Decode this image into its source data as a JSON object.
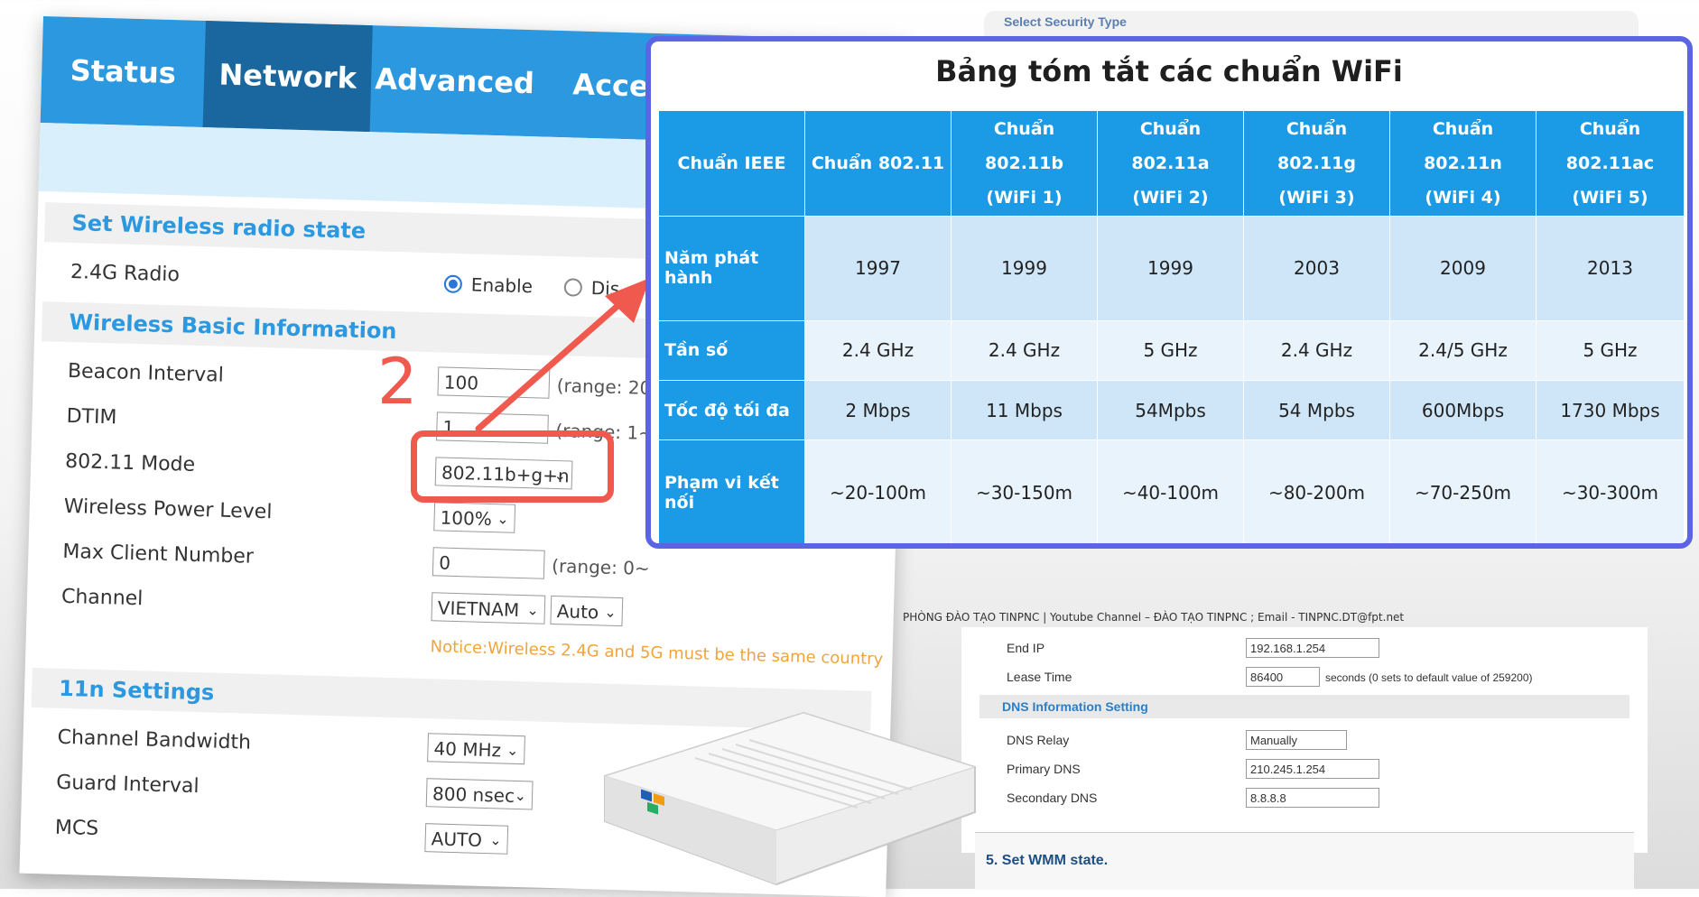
{
  "router_ui": {
    "tabs": [
      "Status",
      "Network",
      "Advanced",
      "Acces"
    ],
    "active_tab": "Network",
    "sections": {
      "radio_state": "Set Wireless radio state",
      "basic_info": "Wireless Basic Information",
      "n11": "11n Settings"
    },
    "radio": {
      "label": "2.4G Radio",
      "enable": "Enable",
      "disable": "Dis",
      "selected": "Enable"
    },
    "fields": {
      "beacon_interval": {
        "label": "Beacon Interval",
        "value": "100",
        "range": "(range: 20"
      },
      "dtim": {
        "label": "DTIM",
        "value": "1",
        "range": "(range: 1~"
      },
      "mode": {
        "label": "802.11 Mode",
        "value": "802.11b+g+n"
      },
      "power": {
        "label": "Wireless Power Level",
        "value": "100%"
      },
      "max_client": {
        "label": "Max Client Number",
        "value": "0",
        "range": "(range: 0~"
      },
      "channel": {
        "label": "Channel",
        "country": "VIETNAM",
        "value": "Auto"
      },
      "bandwidth": {
        "label": "Channel Bandwidth",
        "value": "40 MHz"
      },
      "guard": {
        "label": "Guard Interval",
        "value": "800 nsec"
      },
      "mcs": {
        "label": "MCS",
        "value": "AUTO"
      }
    },
    "notice": "Notice:Wireless 2.4G and 5G must be the same country"
  },
  "background_page": {
    "security_type_label": "Select Security Type",
    "footer": "PHÒNG ĐÀO TẠO TINPNC | Youtube Channel – ĐÀO TẠO TINPNC ; Email - TINPNC.DT@fpt.net",
    "end_ip": {
      "label": "End IP",
      "value": "192.168.1.254"
    },
    "lease_time": {
      "label": "Lease Time",
      "value": "86400",
      "note": "seconds (0 sets to default value of 259200)"
    },
    "dns_section": "DNS Information Setting",
    "dns_relay": {
      "label": "DNS Relay",
      "value": "Manually"
    },
    "primary_dns": {
      "label": "Primary DNS",
      "value": "210.245.1.254"
    },
    "secondary_dns": {
      "label": "Secondary DNS",
      "value": "8.8.8.8"
    },
    "wmm": "5. Set WMM state."
  },
  "annotation": {
    "number": "2"
  },
  "wifi_table": {
    "title": "Bảng tóm tắt các chuẩn WiFi",
    "header_corner": "Chuẩn IEEE",
    "columns": [
      {
        "line1": "Chuẩn 802.11",
        "line2": ""
      },
      {
        "line1": "Chuẩn 802.11b",
        "line2": "(WiFi 1)"
      },
      {
        "line1": "Chuẩn 802.11a",
        "line2": "(WiFi 2)"
      },
      {
        "line1": "Chuẩn 802.11g",
        "line2": "(WiFi 3)"
      },
      {
        "line1": "Chuẩn 802.11n",
        "line2": "(WiFi 4)"
      },
      {
        "line1": "Chuẩn 802.11ac",
        "line2": "(WiFi 5)"
      }
    ],
    "rows": [
      {
        "label": "Năm phát hành",
        "values": [
          "1997",
          "1999",
          "1999",
          "2003",
          "2009",
          "2013"
        ]
      },
      {
        "label": "Tần số",
        "values": [
          "2.4 GHz",
          "2.4 GHz",
          "5 GHz",
          "2.4 GHz",
          "2.4/5 GHz",
          "5 GHz"
        ]
      },
      {
        "label": "Tốc độ tối đa",
        "values": [
          "2 Mbps",
          "11 Mbps",
          "54Mpbs",
          "54 Mpbs",
          "600Mbps",
          "1730 Mbps"
        ]
      },
      {
        "label": "Phạm vi kết nối",
        "values": [
          "~20-100m",
          "~30-150m",
          "~40-100m",
          "~80-200m",
          "~70-250m",
          "~30-300m"
        ]
      }
    ]
  },
  "colors": {
    "tab_bar": "#2c98df",
    "tab_active": "#1a679f",
    "table_header": "#1b9ae6",
    "overlay_border": "#5c64e6",
    "annotation": "#f05a4e"
  }
}
